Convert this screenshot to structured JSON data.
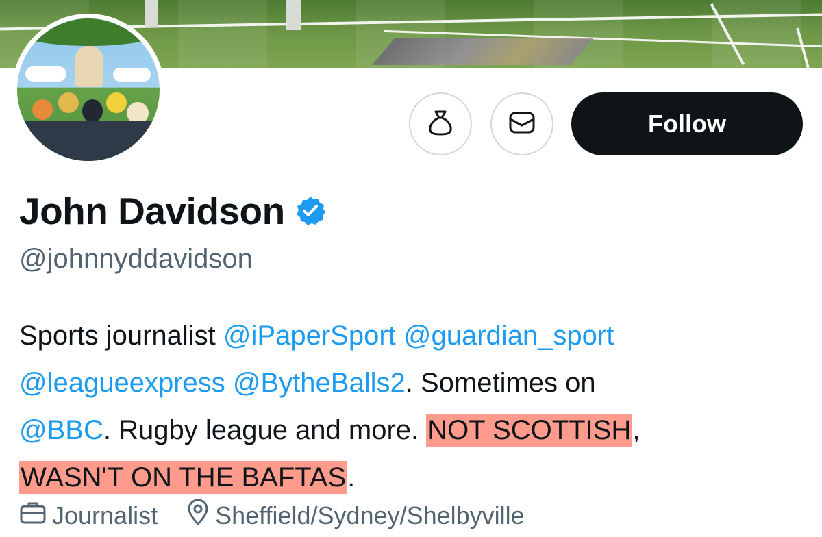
{
  "profile": {
    "name": "John Davidson",
    "handle": "@johnnyddavidson",
    "bio": {
      "t1": "Sports journalist ",
      "m1": "@iPaperSport",
      "t2": " ",
      "m2": "@guardian_sport",
      "m3": "@leagueexpress",
      "t3": " ",
      "m4": "@BytheBalls2",
      "t4": ". Sometimes on",
      "m5": "@BBC",
      "t5": ". Rugby league and more. ",
      "h1": "NOT SCOTTISH",
      "t6": ",",
      "h2": "WASN'T ON THE BAFTAS",
      "t7": "."
    },
    "profession": "Journalist",
    "location": "Sheffield/Sydney/Shelbyville"
  },
  "actions": {
    "follow_label": "Follow",
    "tip_icon": "money-bag-icon",
    "message_icon": "envelope-icon"
  },
  "colors": {
    "mention": "#1d9bf0",
    "highlight": "#ff9b8c",
    "follow_bg": "#0f1419",
    "verified": "#1d9bf0",
    "secondary_text": "#536471"
  }
}
